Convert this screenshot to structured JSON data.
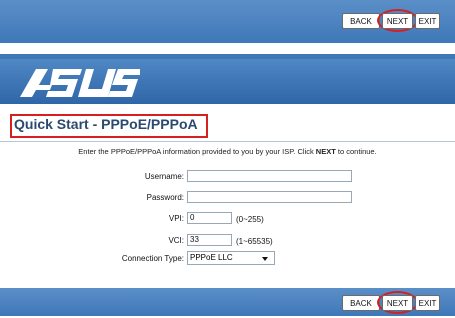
{
  "nav": {
    "back_label": "BACK",
    "next_label": "NEXT",
    "exit_label": "EXIT"
  },
  "brand": {
    "logo_text": "/ISUS"
  },
  "page": {
    "title": "Quick Start - PPPoE/PPPoA",
    "description_prefix": "Enter the PPPoE/PPPoA information provided to you by your ISP. Click ",
    "description_bold": "NEXT",
    "description_suffix": " to continue."
  },
  "form": {
    "username": {
      "label": "Username:",
      "value": ""
    },
    "password": {
      "label": "Password:",
      "value": ""
    },
    "vpi": {
      "label": "VPI:",
      "value": "0",
      "hint": "(0~255)"
    },
    "vci": {
      "label": "VCI:",
      "value": "33",
      "hint": "(1~65535)"
    },
    "connection_type": {
      "label": "Connection Type:",
      "value": "PPPoE LLC"
    }
  },
  "colors": {
    "bar_blue": "#3f78b8",
    "highlight_red": "#d62020",
    "title_color": "#2a4a70"
  }
}
